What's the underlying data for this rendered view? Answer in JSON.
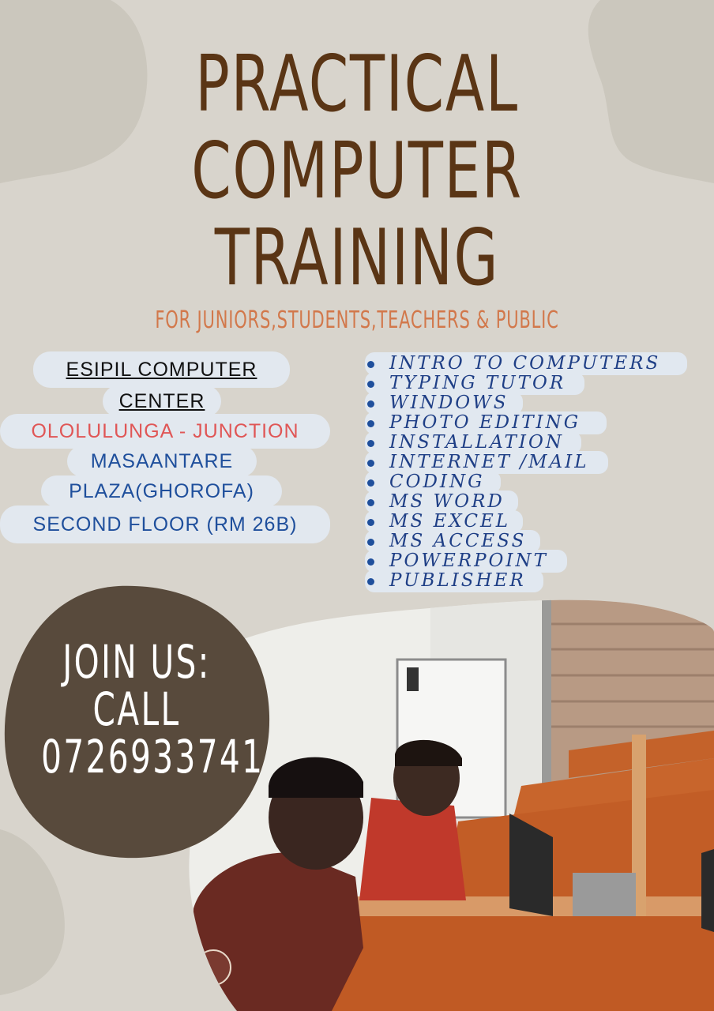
{
  "title": {
    "line1": "PRACTICAL",
    "line2": "COMPUTER",
    "line3": "TRAINING"
  },
  "subtitle": "FOR JUNIORS,STUDENTS,TEACHERS & PUBLIC",
  "center": {
    "name_line1": "ESIPIL COMPUTER",
    "name_line2": "CENTER",
    "address_line1": "OLOLULUNGA - JUNCTION",
    "address_line2": "MASAANTARE",
    "address_line3": "PLAZA(GHOROFA)",
    "address_line4": "SECOND FLOOR (RM 26B)"
  },
  "courses": [
    "INTRO TO COMPUTERS",
    "TYPING TUTOR",
    "WINDOWS",
    "PHOTO EDITING",
    "INSTALLATION",
    "INTERNET /MAIL",
    "CODING",
    "MS WORD",
    "MS EXCEL",
    "MS ACCESS",
    "POWERPOINT",
    "PUBLISHER"
  ],
  "cta": {
    "line1": "JOIN US:",
    "line2": "CALL",
    "phone": "0726933741"
  },
  "colors": {
    "background": "#d8d4cc",
    "title": "#5a3515",
    "subtitle": "#d2784b",
    "cta_circle": "#584a3c",
    "address_red": "#e05656",
    "address_blue": "#1f4f9c",
    "course_text": "#1f3f86"
  }
}
